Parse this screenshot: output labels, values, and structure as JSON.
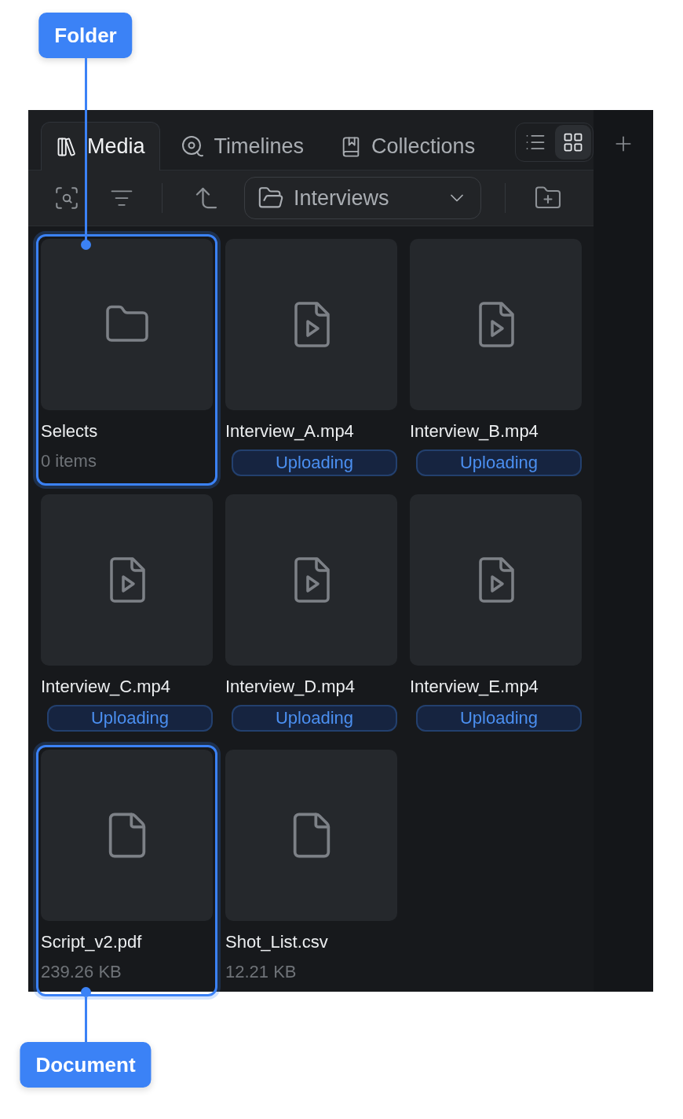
{
  "callout_top": {
    "label": "Folder"
  },
  "tabs": [
    {
      "kind": "media",
      "label": "Media",
      "selected": true
    },
    {
      "kind": "timelines",
      "label": "Timelines",
      "selected": false
    },
    {
      "kind": "collections",
      "label": "Collections",
      "selected": false
    }
  ],
  "view_toggle": [
    {
      "kind": "list",
      "selected": false
    },
    {
      "kind": "grid",
      "selected": true
    }
  ],
  "location": {
    "value": "Interviews"
  },
  "cards": [
    {
      "kind": "folder",
      "name": "Selects",
      "detail": "0 items",
      "highlighted": true
    },
    {
      "kind": "video",
      "name": "Interview_A.mp4",
      "badge": "Uploading",
      "highlighted": false
    },
    {
      "kind": "video",
      "name": "Interview_B.mp4",
      "badge": "Uploading",
      "highlighted": false
    },
    {
      "kind": "video",
      "name": "Interview_C.mp4",
      "badge": "Uploading",
      "highlighted": false
    },
    {
      "kind": "video",
      "name": "Interview_D.mp4",
      "badge": "Uploading",
      "highlighted": false
    },
    {
      "kind": "video",
      "name": "Interview_E.mp4",
      "badge": "Uploading",
      "highlighted": false
    },
    {
      "kind": "document",
      "name": "Script_v2.pdf",
      "detail": "239.26 KB",
      "highlighted": true
    },
    {
      "kind": "document",
      "name": "Shot_List.csv",
      "detail": "12.21 KB",
      "highlighted": false
    }
  ],
  "callout_bottom": {
    "label": "Document"
  }
}
